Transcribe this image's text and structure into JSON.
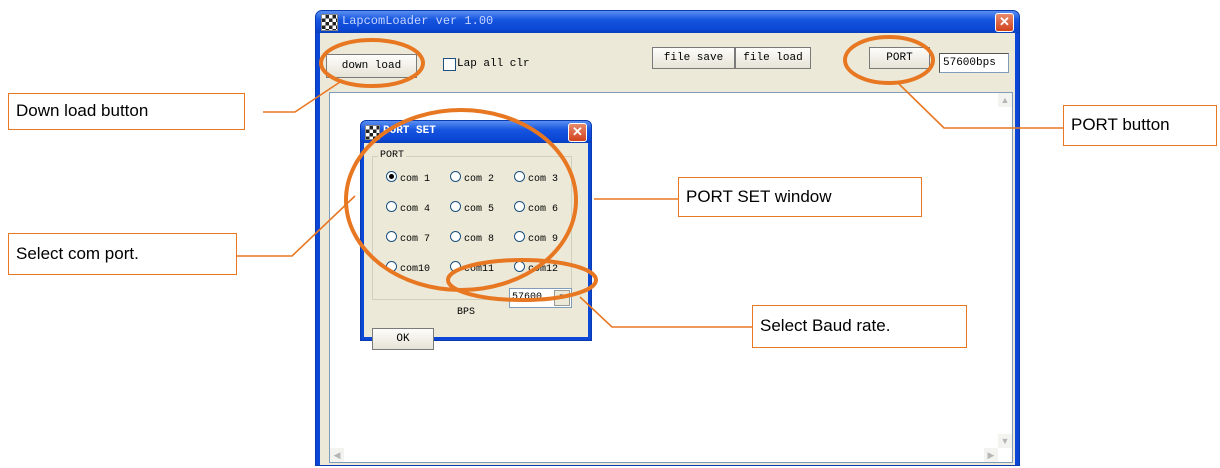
{
  "window": {
    "title": "LapcomLoader  ver 1.00",
    "close_glyph": "✕"
  },
  "toolbar": {
    "download_label": "down load",
    "lap_all_clr_label": "Lap all clr",
    "file_save_label": "file save",
    "file_load_label": "file load",
    "port_label": "PORT",
    "bps_readout": "57600bps"
  },
  "dialog": {
    "title": "PORT SET",
    "close_glyph": "✕",
    "group_label": "PORT",
    "ports": [
      "com 1",
      "com 2",
      "com 3",
      "com 4",
      "com 5",
      "com 6",
      "com 7",
      "com 8",
      "com 9",
      "com10",
      "com11",
      "com12"
    ],
    "selected_port": "com 1",
    "bps_label": "BPS",
    "bps_value": "57600",
    "ok_label": "OK"
  },
  "callouts": {
    "download": "Down load button",
    "port": "PORT button",
    "port_set": "PORT SET window",
    "com": "Select com port.",
    "baud": "Select Baud rate."
  },
  "colors": {
    "annotation": "#e87722",
    "titlebar": "#0a47d6",
    "dialog_face": "#ece9d8"
  }
}
